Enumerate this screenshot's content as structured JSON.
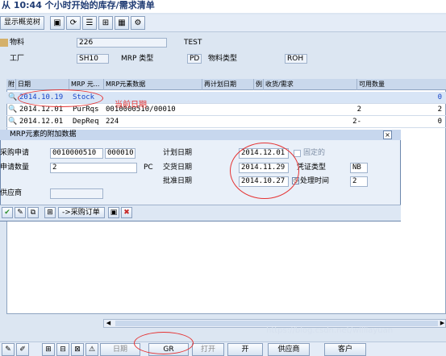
{
  "window": {
    "title": "从 10:44 个小时开始的库存/需求清单"
  },
  "toolbar": {
    "show_overview": "显示概览树"
  },
  "header": {
    "material_label": "物料",
    "material_value": "226",
    "material_text": "TEST",
    "plant_label": "工厂",
    "plant_value": "SH10",
    "mrp_type_label": "MRP 类型",
    "mrp_type_value": "PD",
    "material_type_label": "物料类型",
    "material_type_value": "ROH"
  },
  "table": {
    "columns": [
      "附",
      "日期",
      "MRP 元...",
      "MRP元素数据",
      "再计划日期",
      "例",
      "收货/需求",
      "可用数量"
    ],
    "rows": [
      {
        "date": "2014.10.19",
        "mrp": "Stock",
        "data": "",
        "qty": "",
        "avail": "0"
      },
      {
        "date": "2014.12.01",
        "mrp": "PurRqs",
        "data": "0010000510/00010",
        "qty": "2",
        "avail": "2"
      },
      {
        "date": "2014.12.01",
        "mrp": "DepReq",
        "data": "224",
        "qty": "2-",
        "avail": "0"
      }
    ],
    "annotation": "当前日期"
  },
  "dialog": {
    "title": "MRP元素的附加数据",
    "purchase_req_label": "采购申请",
    "purchase_req_value": "0010000510",
    "purchase_req_item": "000010",
    "req_qty_label": "申请数量",
    "req_qty_value": "2",
    "req_qty_unit": "PC",
    "vendor_label": "供应商",
    "planned_date_label": "计划日期",
    "planned_date_value": "2014.12.01",
    "delivery_date_label": "交货日期",
    "delivery_date_value": "2014.11.29",
    "release_date_label": "批准日期",
    "release_date_value": "2014.10.27",
    "fixed_label": "固定的",
    "doc_type_label": "凭证类型",
    "doc_type_value": "NB",
    "proc_time_label": "处理时间",
    "proc_time_value": "2",
    "po_button": "->采购订单"
  },
  "bottombar": {
    "schedule": "日期",
    "gr": "GR",
    "open": "打开",
    "open2": "开",
    "vendor": "供应商",
    "customer": "客户"
  },
  "watermark": "https://blog.csdn.net/williayuan"
}
